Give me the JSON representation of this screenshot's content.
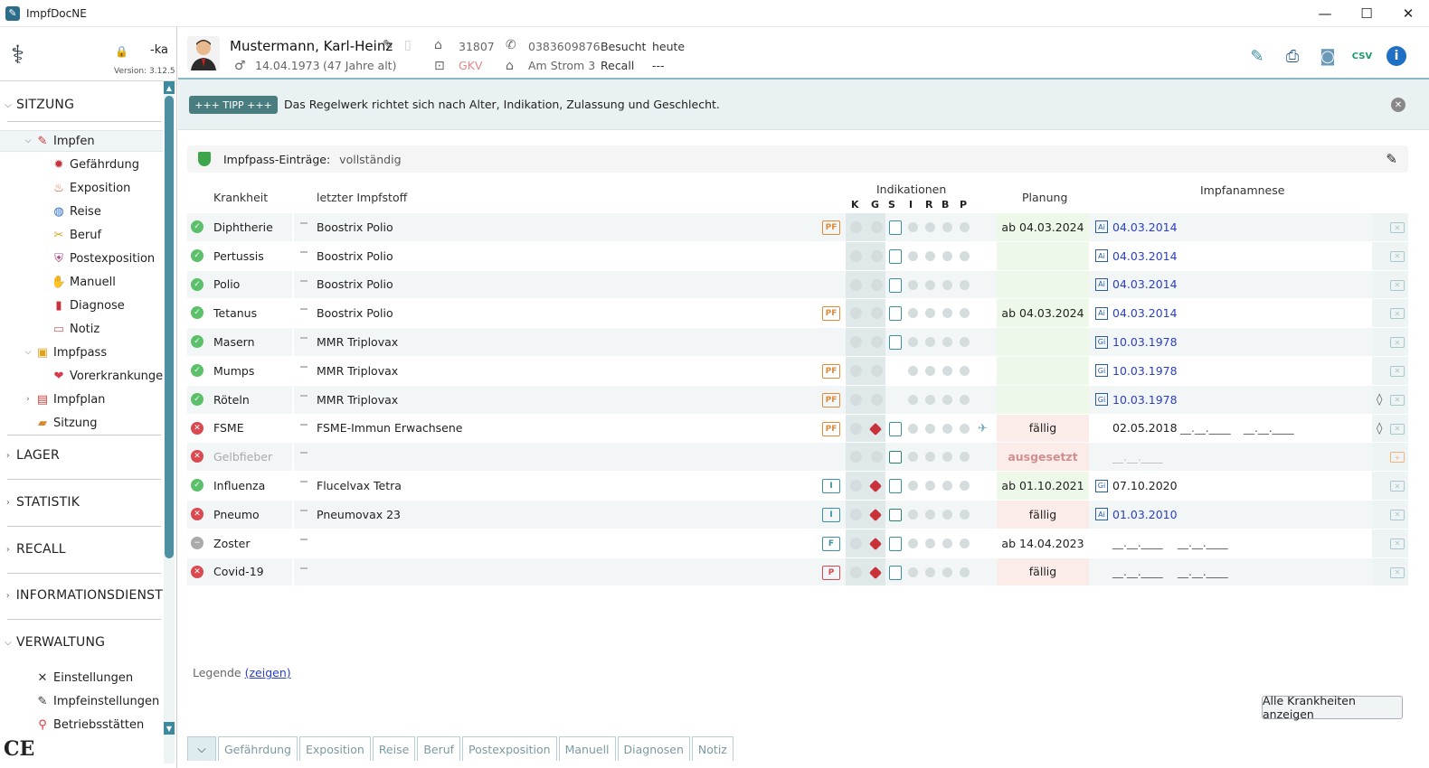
{
  "window": {
    "title": "ImpfDocNE",
    "minimize": "—",
    "maximize": "☐",
    "close": "✕"
  },
  "app": {
    "user": "-ka",
    "version": "Version: 3.12.5"
  },
  "patient": {
    "name": "Mustermann, Karl-Heinz",
    "dob": "14.04.1973",
    "age": "(47 Jahre alt)",
    "id": "31807",
    "insurance": "GKV",
    "phone": "0383609876",
    "street": "Am Strom 3",
    "visited_label": "Besucht",
    "visited_value": "heute",
    "recall_label": "Recall",
    "recall_value": "---"
  },
  "sidebar": {
    "sitzung": "SITZUNG",
    "lager": "LAGER",
    "statistik": "STATISTIK",
    "recall": "RECALL",
    "informationsdienst": "INFORMATIONSDIENST",
    "verwaltung": "VERWALTUNG",
    "items": {
      "impfen": "Impfen",
      "gefaehrdung": "Gefährdung",
      "exposition": "Exposition",
      "reise": "Reise",
      "beruf": "Beruf",
      "postexposition": "Postexposition",
      "manuell": "Manuell",
      "diagnose": "Diagnose",
      "notiz": "Notiz",
      "impfpass": "Impfpass",
      "vorerkrankungen": "Vorerkrankungen",
      "impfplan": "Impfplan",
      "sitzung": "Sitzung",
      "einstellungen": "Einstellungen",
      "impfeinstellungen": "Impfeinstellungen",
      "betriebsstaetten": "Betriebsstätten"
    }
  },
  "tip": {
    "button": "+++ TIPP +++",
    "text": "Das Regelwerk richtet sich nach Alter, Indikation, Zulassung und Geschlecht."
  },
  "impfpass": {
    "label": "Impfpass-Einträge:",
    "value": "vollständig"
  },
  "columns": {
    "krankheit": "Krankheit",
    "impfstoff": "letzter Impfstoff",
    "indikationen": "Indikationen",
    "planung": "Planung",
    "anamnese": "Impfanamnese",
    "ind_letters": [
      "K",
      "G",
      "S",
      "I",
      "R",
      "B",
      "P"
    ]
  },
  "rows": [
    {
      "status": "ok",
      "disease": "Diphtherie",
      "vaccine": "Boostrix Polio",
      "badge": "PF",
      "plan": "ab 04.03.2024",
      "tag": "Ai",
      "date": "04.03.2014"
    },
    {
      "status": "ok",
      "disease": "Pertussis",
      "vaccine": "Boostrix Polio",
      "badge": "",
      "plan": "",
      "tag": "Ai",
      "date": "04.03.2014"
    },
    {
      "status": "ok",
      "disease": "Polio",
      "vaccine": "Boostrix Polio",
      "badge": "",
      "plan": "",
      "tag": "Ai",
      "date": "04.03.2014"
    },
    {
      "status": "ok",
      "disease": "Tetanus",
      "vaccine": "Boostrix Polio",
      "badge": "PF",
      "plan": "ab 04.03.2024",
      "tag": "Ai",
      "date": "04.03.2014"
    },
    {
      "status": "ok",
      "disease": "Masern",
      "vaccine": "MMR Triplovax",
      "badge": "",
      "plan": "",
      "tag": "Gi",
      "date": "10.03.1978"
    },
    {
      "status": "ok",
      "disease": "Mumps",
      "vaccine": "MMR Triplovax",
      "badge": "PF",
      "plan": "",
      "tag": "Gi",
      "date": "10.03.1978"
    },
    {
      "status": "ok",
      "disease": "Röteln",
      "vaccine": "MMR Triplovax",
      "badge": "PF",
      "plan": "",
      "tag": "Gi",
      "date": "10.03.1978"
    },
    {
      "status": "bad",
      "disease": "FSME",
      "vaccine": "FSME-Immun Erwachsene",
      "badge": "PF",
      "plan": "fällig",
      "tag": "",
      "date": "02.05.2018"
    },
    {
      "status": "bad",
      "disease": "Gelbfieber",
      "vaccine": "",
      "badge": "",
      "plan": "ausgesetzt",
      "tag": "",
      "date": ""
    },
    {
      "status": "ok",
      "disease": "Influenza",
      "vaccine": "Flucelvax Tetra",
      "badge": "I",
      "plan": "ab 01.10.2021",
      "tag": "Gi",
      "date": "07.10.2020"
    },
    {
      "status": "bad",
      "disease": "Pneumo",
      "vaccine": "Pneumovax 23",
      "badge": "I",
      "plan": "fällig",
      "tag": "Ai",
      "date": "01.03.2010"
    },
    {
      "status": "neu",
      "disease": "Zoster",
      "vaccine": "",
      "badge": "F",
      "plan": "ab 14.04.2023",
      "tag": "",
      "date": ""
    },
    {
      "status": "bad",
      "disease": "Covid-19",
      "vaccine": "",
      "badge": "P",
      "plan": "fällig",
      "tag": "",
      "date": ""
    }
  ],
  "blank_date": "__.__.____",
  "legend": {
    "label": "Legende",
    "link": "(zeigen)"
  },
  "all_button": "Alle Krankheiten anzeigen",
  "tabs": [
    "Gefährdung",
    "Exposition",
    "Reise",
    "Beruf",
    "Postexposition",
    "Manuell",
    "Diagnosen",
    "Notiz"
  ]
}
